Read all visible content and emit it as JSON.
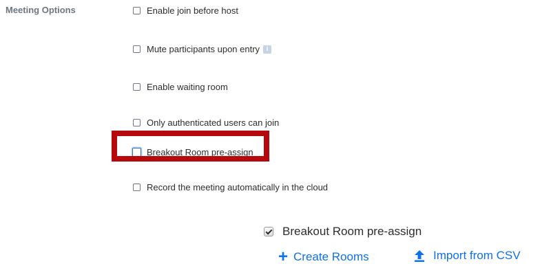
{
  "section": {
    "label": "Meeting Options"
  },
  "options": [
    {
      "label": "Enable join before host",
      "checked": false
    },
    {
      "label": "Mute participants upon entry",
      "checked": false,
      "icon": "info-icon"
    },
    {
      "label": "Enable waiting room",
      "checked": false
    },
    {
      "label": "Only authenticated users can join",
      "checked": false
    },
    {
      "label": "Breakout Room pre-assign",
      "checked": false,
      "highlighted": true
    },
    {
      "label": "Record the meeting automatically in the cloud",
      "checked": false
    }
  ],
  "breakout_detail": {
    "label": "Breakout Room pre-assign",
    "checked": true,
    "create_label": "Create Rooms",
    "import_label": "Import from CSV"
  },
  "colors": {
    "highlight_border": "#b5090d",
    "link": "#0e71eb",
    "section_label": "#6e7680"
  }
}
